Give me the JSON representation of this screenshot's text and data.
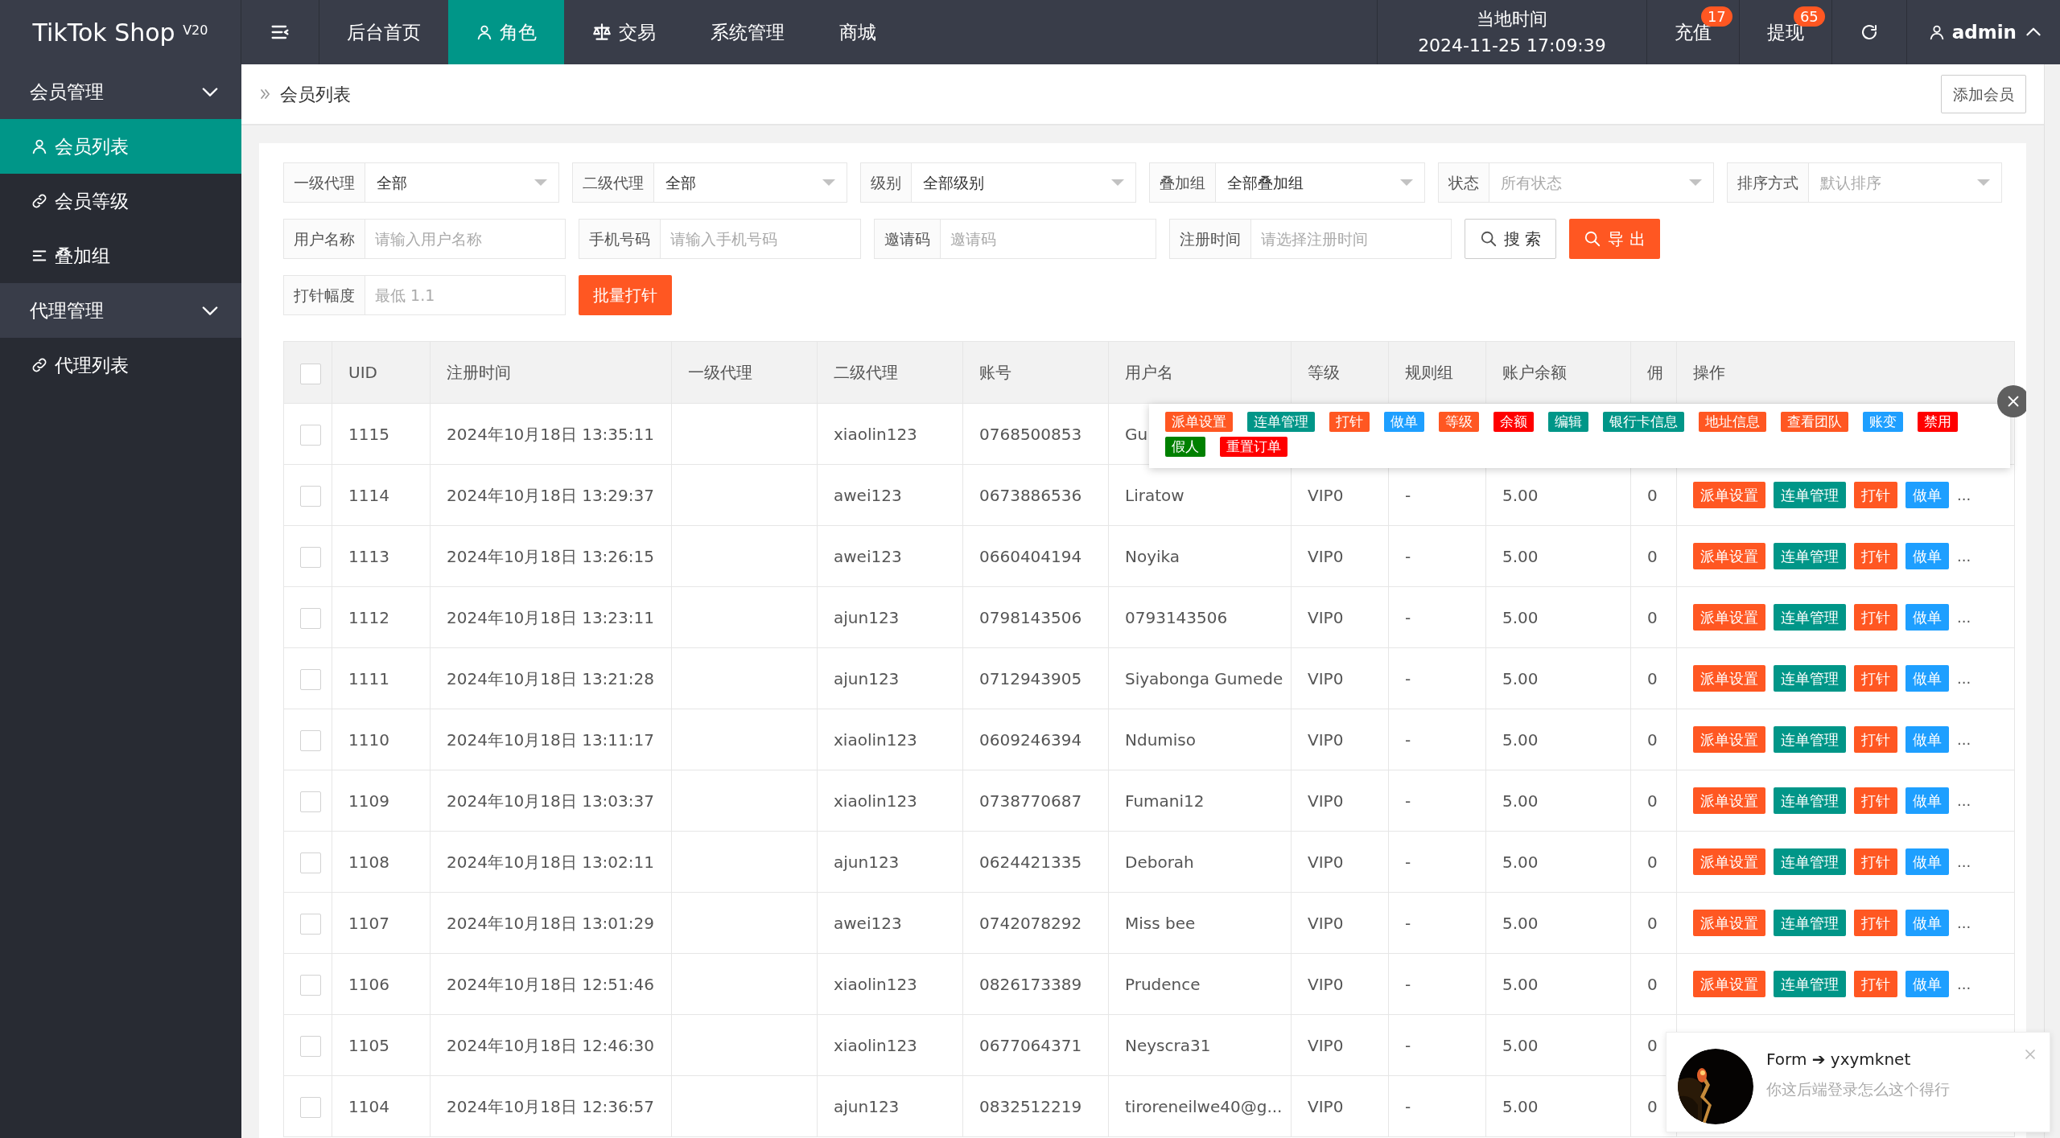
{
  "brand": {
    "name": "TikTok Shop",
    "version": "V20"
  },
  "top_nav": [
    {
      "kind": "menu"
    },
    {
      "kind": "text",
      "label": "后台首页",
      "selected": false
    },
    {
      "kind": "user",
      "label": "角色",
      "selected": true
    },
    {
      "kind": "scale",
      "label": "交易",
      "selected": false
    },
    {
      "kind": "text",
      "label": "系统管理",
      "selected": false
    },
    {
      "kind": "text",
      "label": "商城",
      "selected": false
    }
  ],
  "clock": {
    "label": "当地时间",
    "value": "2024-11-25 17:09:39"
  },
  "top_actions": [
    {
      "kind": "text",
      "label": "充值",
      "badge": "17"
    },
    {
      "kind": "text",
      "label": "提现",
      "badge": "65"
    },
    {
      "kind": "refresh"
    }
  ],
  "user": {
    "name": "admin",
    "expanded": true
  },
  "sidebar": [
    {
      "label": "会员管理",
      "expanded": true,
      "children": [
        {
          "kind": "user",
          "label": "会员列表",
          "selected": true
        },
        {
          "kind": "link",
          "label": "会员等级",
          "selected": false
        },
        {
          "kind": "list",
          "label": "叠加组",
          "selected": false
        }
      ]
    },
    {
      "label": "代理管理",
      "expanded": true,
      "children": [
        {
          "kind": "link",
          "label": "代理列表",
          "selected": false
        }
      ]
    }
  ],
  "breadcrumb": "会员列表",
  "add_button": "添加会员",
  "filter_rows": [
    [
      {
        "kind": "select",
        "label": "一级代理",
        "value": "全部"
      },
      {
        "kind": "select",
        "label": "二级代理",
        "value": "全部"
      },
      {
        "kind": "select",
        "label": "级别",
        "value": "全部级别"
      },
      {
        "kind": "select",
        "label": "叠加组",
        "value": "全部叠加组"
      },
      {
        "kind": "select",
        "label": "状态",
        "placeholder": "所有状态"
      },
      {
        "kind": "select",
        "label": "排序方式",
        "placeholder": "默认排序"
      }
    ],
    [
      {
        "kind": "input",
        "label": "用户名称",
        "placeholder": "请输入用户名称"
      },
      {
        "kind": "input",
        "label": "手机号码",
        "placeholder": "请输入手机号码"
      },
      {
        "kind": "input",
        "label": "邀请码",
        "placeholder": "邀请码"
      },
      {
        "kind": "input",
        "label": "注册时间",
        "placeholder": "请选择注册时间"
      },
      {
        "kind": "search",
        "label": "搜 索"
      },
      {
        "kind": "export",
        "label": "导 出"
      }
    ],
    [
      {
        "kind": "input",
        "label": "打针幅度",
        "placeholder": "最低 1.1"
      },
      {
        "kind": "primary",
        "label": "批量打针"
      }
    ]
  ],
  "table": {
    "all_checked": false,
    "columns": [
      "UID",
      "注册时间",
      "一级代理",
      "二级代理",
      "账号",
      "用户名",
      "等级",
      "规则组",
      "账户余额",
      "佣",
      "操作"
    ],
    "rows": [
      {
        "checked": false,
        "cells": [
          "1115",
          "2024年10月18日 13:35:11",
          null,
          "xiaolin123",
          "0768500853",
          "Gu",
          null,
          null,
          null,
          null
        ],
        "actions": []
      },
      {
        "checked": false,
        "cells": [
          "1114",
          "2024年10月18日 13:29:37",
          null,
          "awei123",
          "0673886536",
          "Liratow",
          "VIP0",
          "-",
          "5.00",
          "0"
        ],
        "actions": [
          {
            "label": "派单设置",
            "color": "#ff5722"
          },
          {
            "label": "连单管理",
            "color": "#009688"
          },
          {
            "label": "打针",
            "color": "#ff5722"
          },
          {
            "label": "做单",
            "color": "#1e9fff"
          }
        ],
        "more": "..."
      },
      {
        "checked": false,
        "cells": [
          "1113",
          "2024年10月18日 13:26:15",
          null,
          "awei123",
          "0660404194",
          "Noyika",
          "VIP0",
          "-",
          "5.00",
          "0"
        ],
        "actions": [
          {
            "label": "派单设置",
            "color": "#ff5722"
          },
          {
            "label": "连单管理",
            "color": "#009688"
          },
          {
            "label": "打针",
            "color": "#ff5722"
          },
          {
            "label": "做单",
            "color": "#1e9fff"
          }
        ],
        "more": "..."
      },
      {
        "checked": false,
        "cells": [
          "1112",
          "2024年10月18日 13:23:11",
          null,
          "ajun123",
          "0798143506",
          "0793143506",
          "VIP0",
          "-",
          "5.00",
          "0"
        ],
        "actions": [
          {
            "label": "派单设置",
            "color": "#ff5722"
          },
          {
            "label": "连单管理",
            "color": "#009688"
          },
          {
            "label": "打针",
            "color": "#ff5722"
          },
          {
            "label": "做单",
            "color": "#1e9fff"
          }
        ],
        "more": "..."
      },
      {
        "checked": false,
        "cells": [
          "1111",
          "2024年10月18日 13:21:28",
          null,
          "ajun123",
          "0712943905",
          "Siyabonga Gumede",
          "VIP0",
          "-",
          "5.00",
          "0"
        ],
        "actions": [
          {
            "label": "派单设置",
            "color": "#ff5722"
          },
          {
            "label": "连单管理",
            "color": "#009688"
          },
          {
            "label": "打针",
            "color": "#ff5722"
          },
          {
            "label": "做单",
            "color": "#1e9fff"
          }
        ],
        "more": "..."
      },
      {
        "checked": false,
        "cells": [
          "1110",
          "2024年10月18日 13:11:17",
          null,
          "xiaolin123",
          "0609246394",
          "Ndumiso",
          "VIP0",
          "-",
          "5.00",
          "0"
        ],
        "actions": [
          {
            "label": "派单设置",
            "color": "#ff5722"
          },
          {
            "label": "连单管理",
            "color": "#009688"
          },
          {
            "label": "打针",
            "color": "#ff5722"
          },
          {
            "label": "做单",
            "color": "#1e9fff"
          }
        ],
        "more": "..."
      },
      {
        "checked": false,
        "cells": [
          "1109",
          "2024年10月18日 13:03:37",
          null,
          "xiaolin123",
          "0738770687",
          "Fumani12",
          "VIP0",
          "-",
          "5.00",
          "0"
        ],
        "actions": [
          {
            "label": "派单设置",
            "color": "#ff5722"
          },
          {
            "label": "连单管理",
            "color": "#009688"
          },
          {
            "label": "打针",
            "color": "#ff5722"
          },
          {
            "label": "做单",
            "color": "#1e9fff"
          }
        ],
        "more": "..."
      },
      {
        "checked": false,
        "cells": [
          "1108",
          "2024年10月18日 13:02:11",
          null,
          "ajun123",
          "0624421335",
          "Deborah",
          "VIP0",
          "-",
          "5.00",
          "0"
        ],
        "actions": [
          {
            "label": "派单设置",
            "color": "#ff5722"
          },
          {
            "label": "连单管理",
            "color": "#009688"
          },
          {
            "label": "打针",
            "color": "#ff5722"
          },
          {
            "label": "做单",
            "color": "#1e9fff"
          }
        ],
        "more": "..."
      },
      {
        "checked": false,
        "cells": [
          "1107",
          "2024年10月18日 13:01:29",
          null,
          "awei123",
          "0742078292",
          "Miss bee",
          "VIP0",
          "-",
          "5.00",
          "0"
        ],
        "actions": [
          {
            "label": "派单设置",
            "color": "#ff5722"
          },
          {
            "label": "连单管理",
            "color": "#009688"
          },
          {
            "label": "打针",
            "color": "#ff5722"
          },
          {
            "label": "做单",
            "color": "#1e9fff"
          }
        ],
        "more": "..."
      },
      {
        "checked": false,
        "cells": [
          "1106",
          "2024年10月18日 12:51:46",
          null,
          "xiaolin123",
          "0826173389",
          "Prudence",
          "VIP0",
          "-",
          "5.00",
          "0"
        ],
        "actions": [
          {
            "label": "派单设置",
            "color": "#ff5722"
          },
          {
            "label": "连单管理",
            "color": "#009688"
          },
          {
            "label": "打针",
            "color": "#ff5722"
          },
          {
            "label": "做单",
            "color": "#1e9fff"
          }
        ],
        "more": "..."
      },
      {
        "checked": false,
        "cells": [
          "1105",
          "2024年10月18日 12:46:30",
          null,
          "xiaolin123",
          "0677064371",
          "Neyscra31",
          "VIP0",
          "-",
          "5.00",
          "0"
        ],
        "actions": []
      },
      {
        "checked": false,
        "cells": [
          "1104",
          "2024年10月18日 12:36:57",
          null,
          "ajun123",
          "0832512219",
          "tiroreneilwe40@g...",
          "VIP0",
          "-",
          "5.00",
          "0"
        ],
        "actions": []
      }
    ]
  },
  "action_popup": {
    "buttons": [
      {
        "label": "派单设置",
        "color": "#ff5722"
      },
      {
        "label": "连单管理",
        "color": "#009688"
      },
      {
        "label": "打针",
        "color": "#ff5722"
      },
      {
        "label": "做单",
        "color": "#1e9fff"
      },
      {
        "label": "等级",
        "color": "#ff5722"
      },
      {
        "label": "余额",
        "color": "#ff0000"
      },
      {
        "label": "编辑",
        "color": "#009688"
      },
      {
        "label": "银行卡信息",
        "color": "#009688"
      },
      {
        "label": "地址信息",
        "color": "#ff5722"
      },
      {
        "label": "查看团队",
        "color": "#ff5722"
      },
      {
        "label": "账变",
        "color": "#1e9fff"
      },
      {
        "label": "禁用",
        "color": "#ff0000"
      },
      {
        "label": "假人",
        "color": "#008000"
      },
      {
        "label": "重置订单",
        "color": "#ff0000"
      }
    ]
  },
  "toast": {
    "title": "Form ➔ yxymknet",
    "message": "你这后端登录怎么这个得行"
  }
}
